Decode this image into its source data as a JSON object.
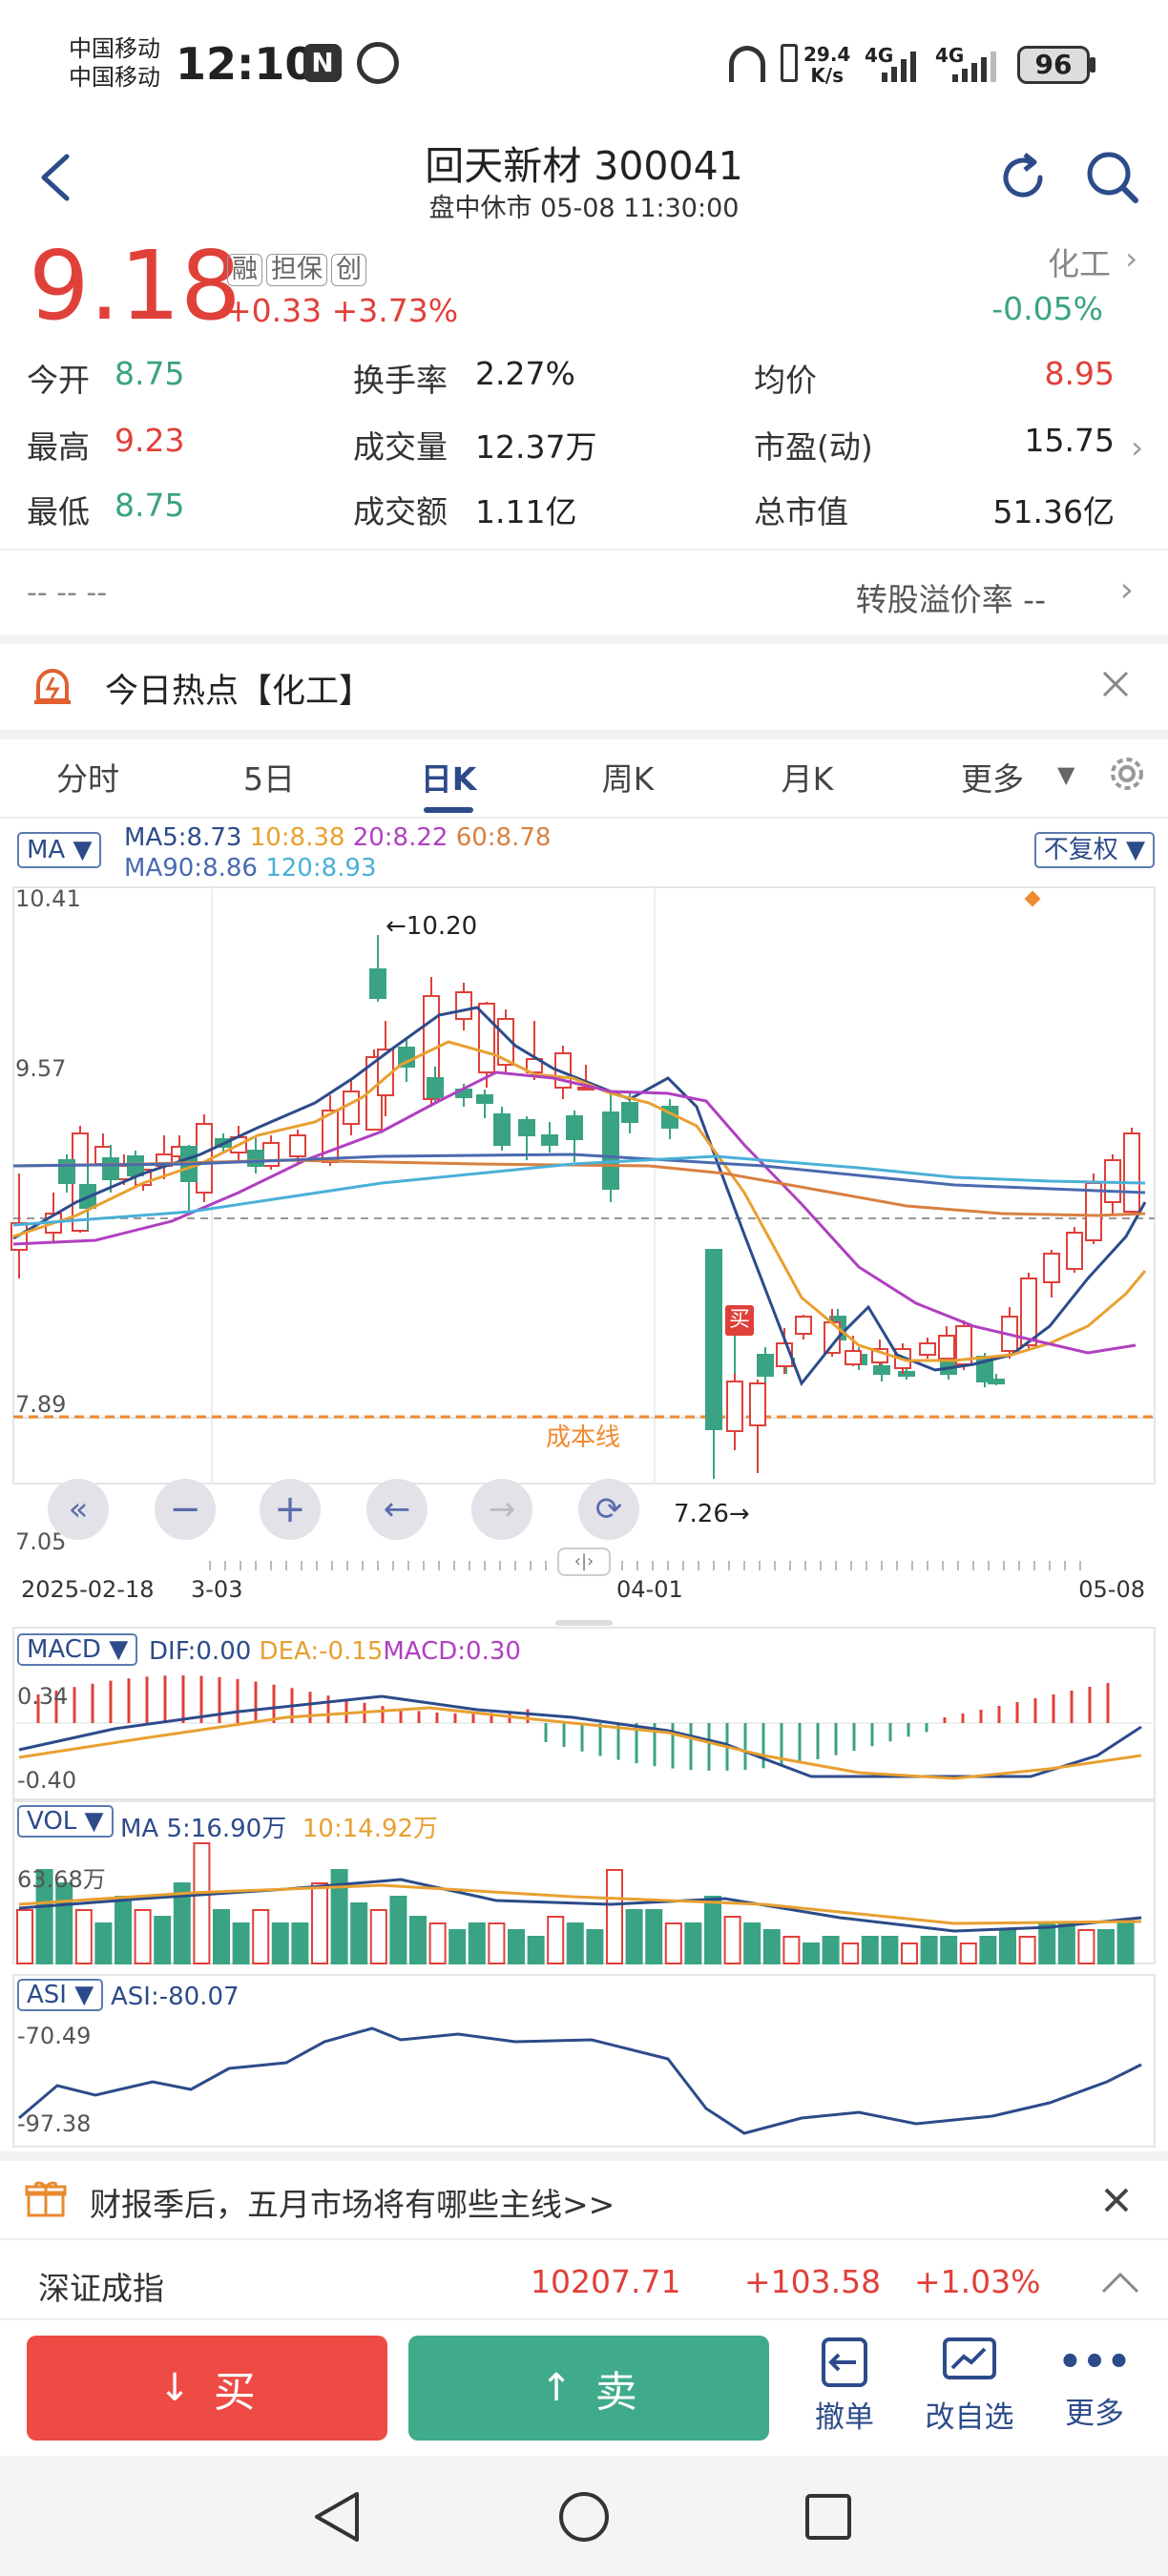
{
  "status_bar": {
    "carrier1": "中国移动",
    "carrier2": "中国移动",
    "time": "12:10",
    "net_speed_top": "29.4",
    "net_speed_bottom": "K/s",
    "sig1": "4G",
    "sig2": "4G",
    "battery": "96"
  },
  "header": {
    "title": "回天新材 300041",
    "subtitle": "盘中休市 05-08 11:30:00"
  },
  "quote": {
    "price": "9.18",
    "change": "+0.33",
    "change_pct": "+3.73%",
    "tags": [
      "融",
      "担保",
      "创"
    ],
    "sector_name": "化工",
    "sector_change": "-0.05%"
  },
  "stats": {
    "open_label": "今开",
    "open": "8.75",
    "high_label": "最高",
    "high": "9.23",
    "low_label": "最低",
    "low": "8.75",
    "turnover_label": "换手率",
    "turnover": "2.27%",
    "volume_label": "成交量",
    "volume": "12.37万",
    "amount_label": "成交额",
    "amount": "1.11亿",
    "avg_label": "均价",
    "avg": "8.95",
    "pe_label": "市盈(动)",
    "pe": "15.75",
    "mcap_label": "总市值",
    "mcap": "51.36亿"
  },
  "premium": {
    "left": "-- -- --",
    "label": "转股溢价率 --"
  },
  "hot": {
    "text": "今日热点【化工】"
  },
  "tabs": [
    {
      "label": "分时"
    },
    {
      "label": "5日"
    },
    {
      "label": "日K"
    },
    {
      "label": "周K"
    },
    {
      "label": "月K"
    },
    {
      "label": "更多"
    }
  ],
  "ma_legend": {
    "btn": "MA",
    "ma5": "MA5:8.73",
    "ma10": "10:8.38",
    "ma20": "20:8.22",
    "ma60": "60:8.78",
    "ma90": "MA90:8.86",
    "ma120": "120:8.93",
    "adjust": "不复权"
  },
  "kline": {
    "y_top": "10.41",
    "y_mid": "9.57",
    "y_low": "7.89",
    "y_bottom": "7.05",
    "max_label": "←10.20",
    "min_label": "7.26→",
    "cost_label": "成本线",
    "buy_marker": "买",
    "date_start": "2025-02-18",
    "date_2": "3-03",
    "date_3": "04-01",
    "date_end": "05-08"
  },
  "macd": {
    "btn": "MACD",
    "dif": "DIF:0.00",
    "dea": "DEA:-0.15",
    "macd": "MACD:0.30",
    "y_top": "0.34",
    "y_bottom": "-0.40"
  },
  "vol": {
    "btn": "VOL",
    "ma5": "MA 5:16.90万",
    "ma10": "10:14.92万",
    "y_top": "63.68万"
  },
  "asi": {
    "btn": "ASI",
    "asi": "ASI:-80.07",
    "y_top": "-70.49",
    "y_bottom": "-97.38"
  },
  "news": {
    "text": "财报季后，五月市场将有哪些主线>>"
  },
  "index": {
    "name": "深证成指",
    "value": "10207.71",
    "change": "+103.58",
    "pct": "+1.03%"
  },
  "actions": {
    "buy": "买",
    "sell": "卖",
    "cancel": "撤单",
    "edit": "改自选",
    "more": "更多"
  },
  "colors": {
    "up": "#e0403a",
    "down": "#3aa384",
    "accent": "#2c4b8a",
    "cost": "#f08a30"
  }
}
